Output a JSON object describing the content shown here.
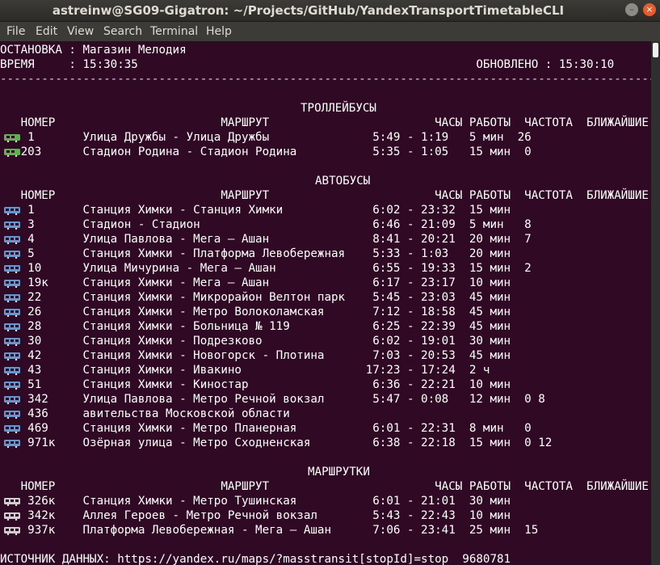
{
  "window": {
    "title": "astreinw@SG09-Gigatron: ~/Projects/GitHub/YandexTransportTimetableCLI",
    "close_glyph": "×",
    "minimize_glyph": "–"
  },
  "menu": [
    "File",
    "Edit",
    "View",
    "Search",
    "Terminal",
    "Help"
  ],
  "colors": {
    "terminal_bg": "#300a24",
    "trolleybus_icon": "#5fb04f",
    "bus_icon": "#5a9bd6",
    "minibus_icon": "#cfcfcf"
  },
  "header": {
    "stop": "ОСТАНОВКА : Магазин Мелодия",
    "time_row": "ВРЕМЯ     : 15:30:35                                                 ОБНОВЛЕНО : 15:30:10",
    "separator": "--------------------------------------------------------------------------------------------------"
  },
  "sections": {
    "trolleybus": {
      "title": "ТРОЛЛЕЙБУСЫ",
      "columns": "   НОМЕР                        МАРШРУТ                        ЧАСЫ РАБОТЫ  ЧАСТОТА  БЛИЖАЙШИЕ",
      "rows": [
        "    1       Улица Дружбы - Улица Дружбы               5:49 - 1:19   5 мин  26",
        "   203      Стадион Родина - Стадион Родина           5:35 - 1:05   15 мин  0"
      ]
    },
    "bus": {
      "title": "АВТОБУСЫ",
      "columns": "   НОМЕР                        МАРШРУТ                        ЧАСЫ РАБОТЫ  ЧАСТОТА  БЛИЖАЙШИЕ",
      "rows": [
        "    1       Станция Химки - Станция Химки             6:02 - 23:32  15 мин",
        "    3       Стадион - Стадион                         6:46 - 21:09  5 мин   8",
        "    4       Улица Павлова - Мега – Ашан               8:41 - 20:21  20 мин  7",
        "    5       Станция Химки - Платформа Левобережная    5:33 - 1:03   20 мин",
        "    10      Улица Мичурина - Мега – Ашан              6:55 - 19:33  15 мин  2",
        "    19к     Станция Химки - Мега – Ашан               6:17 - 23:17  10 мин",
        "    22      Станция Химки - Микрорайон Велтон парк    5:45 - 23:03  45 мин",
        "    26      Станция Химки - Метро Волоколамская       7:12 - 18:58  45 мин",
        "    28      Станция Химки - Больница № 119            6:25 - 22:39  45 мин",
        "    30      Станция Химки - Подрезково                6:02 - 19:01  30 мин",
        "    42      Станция Химки - Новогорск - Плотина       7:03 - 20:53  45 мин",
        "    43      Станция Химки - Ивакино                  17:23 - 17:24  2 ч",
        "    51      Станция Химки - Киностар                  6:36 - 22:21  10 мин",
        "    342     Улица Павлова - Метро Речной вокзал       5:47 - 0:08   12 мин  0 8",
        "    436     авительства Московской области",
        "    469     Станция Химки - Метро Планерная           6:01 - 22:31  8 мин   0",
        "    971к    Озёрная улица - Метро Сходненская         6:38 - 22:18  15 мин  0 12"
      ]
    },
    "minibus": {
      "title": "МАРШРУТКИ",
      "columns": "   НОМЕР                        МАРШРУТ                        ЧАСЫ РАБОТЫ  ЧАСТОТА  БЛИЖАЙШИЕ",
      "rows": [
        "    326к    Станция Химки - Метро Тушинская           6:01 - 21:01  30 мин",
        "    342к    Аллея Героев - Метро Речной вокзал        5:43 - 22:43  10 мин",
        "    937к    Платформа Левобережная - Мега – Ашан      7:06 - 23:41  25 мин  15"
      ]
    }
  },
  "footer": "ИСТОЧНИК ДАННЫХ: https://yandex.ru/maps/?masstransit[stopId]=stop  9680781"
}
